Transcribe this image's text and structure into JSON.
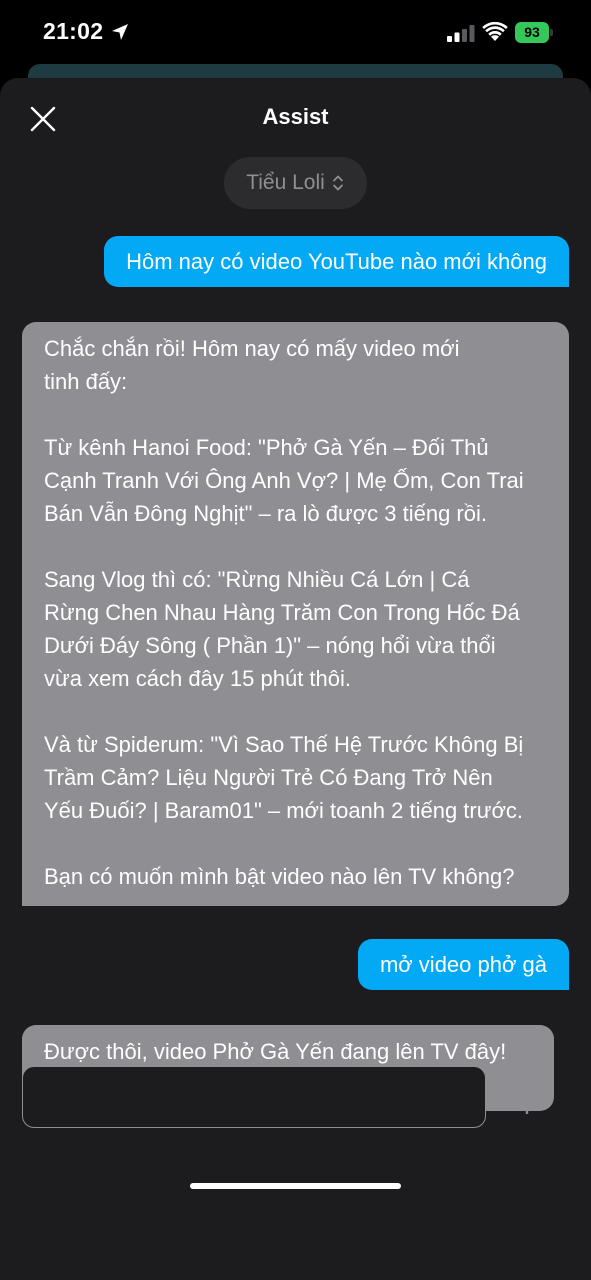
{
  "status_bar": {
    "time": "21:02",
    "battery": "93",
    "battery_color": "#34c759"
  },
  "sheet": {
    "title": "Assist",
    "close_icon": "close-icon"
  },
  "agent_picker": {
    "label": "Tiểu Loli",
    "icon": "chevron-up-down-icon"
  },
  "conversation": {
    "messages": [
      {
        "role": "user",
        "text": "Hôm nay có video YouTube nào mới không"
      },
      {
        "role": "assistant",
        "text": "Chắc chắn rồi! Hôm nay có mấy video mới\ntinh đấy:\n\nTừ kênh Hanoi Food: \"Phở Gà Yến – Đối Thủ\nCạnh Tranh Với Ông Anh Vợ? | Mẹ Ốm, Con Trai\nBán Vẫn Đông Nghịt\" – ra lò được 3 tiếng rồi.\n\nSang Vlog thì có: \"Rừng Nhiều Cá Lớn | Cá\nRừng Chen Nhau Hàng Trăm Con Trong Hốc Đá\nDưới Đáy Sông ( Phần 1)\" – nóng hổi vừa thổi\nvừa xem cách đây 15 phút thôi.\n\nVà từ Spiderum: \"Vì Sao Thế Hệ Trước Không Bị\nTrầm Cảm? Liệu Người Trẻ Có Đang Trở Nên\nYếu Đuối? | Baram01\" – mới toanh 2 tiếng trước.\n\nBạn có muốn mình bật video nào lên TV không?"
      },
      {
        "role": "user",
        "text": "mở video phở gà"
      },
      {
        "role": "assistant",
        "text": "Được thôi, video Phở Gà Yến đang lên TV đây!\nChúc bạn xem ngon miệng nhé!"
      }
    ],
    "user_bubble_color": "#03a9f4",
    "assistant_bubble_color": "#8e8e93"
  },
  "composer": {
    "value": "",
    "placeholder": "",
    "mic_icon": "microphone-icon"
  }
}
